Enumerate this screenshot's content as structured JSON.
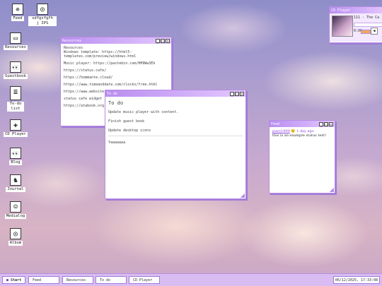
{
  "desktop_icons": [
    {
      "label": "Feed",
      "icon": "pinwheel-icon",
      "glyph": "✵"
    },
    {
      "label": "sdfgsfgfh j IPS",
      "icon": "camera-icon",
      "glyph": "◎"
    },
    {
      "label": "Resources",
      "icon": "folder-icon",
      "glyph": "▭"
    },
    {
      "label": "Guestbook",
      "icon": "eyes-icon",
      "glyph": "👀"
    },
    {
      "label": "To-do list",
      "icon": "notepad-icon",
      "glyph": "≣"
    },
    {
      "label": "CD Player",
      "icon": "bandage-icon",
      "glyph": "✚"
    },
    {
      "label": "Blog",
      "icon": "eyes-icon",
      "glyph": "👀"
    },
    {
      "label": "Journal",
      "icon": "cat-icon",
      "glyph": "♞"
    },
    {
      "label": "Medialog",
      "icon": "character-icon",
      "glyph": "☺"
    },
    {
      "label": "Album",
      "icon": "camera-icon",
      "glyph": "◎"
    }
  ],
  "resources_window": {
    "title": "Resources",
    "lines": [
      "Resources",
      "Windows template: https://html5-templates.com/preview/windows.html",
      "Music player: https://pastebin.com/HH9Ww3Ek",
      "https://status.cafe/",
      "https://hommante.cloud/",
      "https://www.timeanddate.com/clocks/free.html",
      "https://www.website... C=3zaG=3sB0G4aMJ=1",
      "status cafe widget ... https://petrapixel...",
      "https://atabook.org..."
    ]
  },
  "todo_window": {
    "title": "To do",
    "heading": "To do",
    "items": [
      "Update music player with content.",
      "Finish guest book",
      "Update desktop icons"
    ],
    "input_value": "Yaaaaaaa"
  },
  "feed_window": {
    "title": "Feed",
    "user": "puru1999",
    "emoji": "😊",
    "time": "1 day ago",
    "status": "this is an example status text!"
  },
  "cd_window": {
    "title": "CD Player",
    "track": "111 - The Ca",
    "time": "0:00"
  },
  "taskbar": {
    "start": "Start",
    "tasks": [
      "Feed",
      "Resources",
      "To do",
      "CD Player"
    ],
    "clock": "06/12/2025, 17:33:08"
  },
  "colors": {
    "accent": "#b98ef0",
    "taskbar": "#d9bdf2",
    "link": "#8a3ce0"
  }
}
